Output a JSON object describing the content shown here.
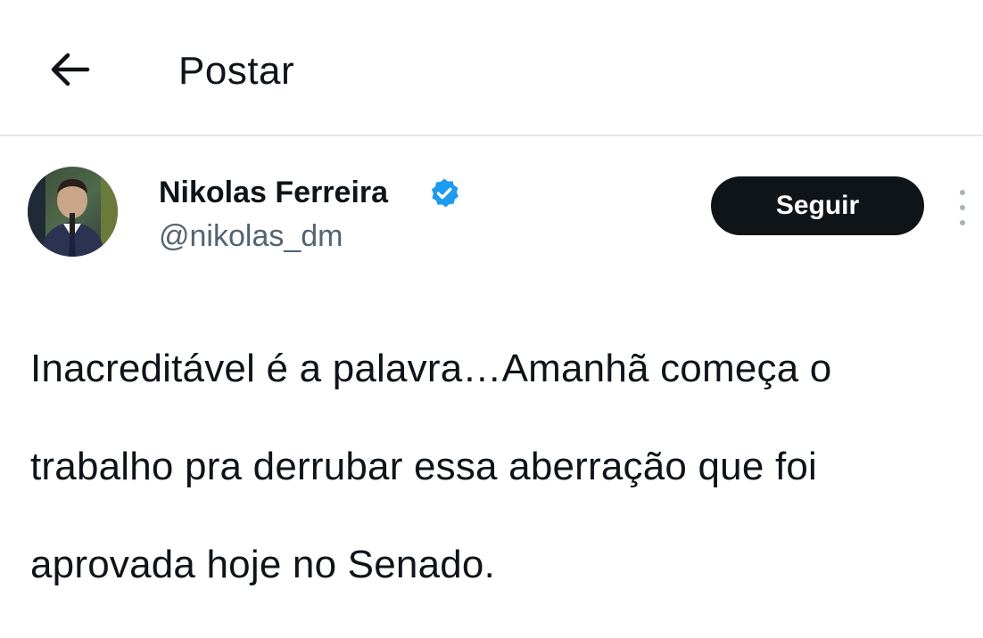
{
  "header": {
    "back_icon": "arrow-left-icon",
    "title": "Postar"
  },
  "post": {
    "author": {
      "name": "Nikolas Ferreira",
      "handle": "@nikolas_dm",
      "verified_icon": "verified-badge-icon",
      "verified_color": "#1d9bf0"
    },
    "follow_label": "Seguir",
    "more_icon": "more-vertical-icon",
    "text_lines": [
      "Inacreditável é a palavra…Amanhã começa o",
      "trabalho pra derrubar essa aberração que foi",
      "aprovada hoje no Senado."
    ]
  }
}
